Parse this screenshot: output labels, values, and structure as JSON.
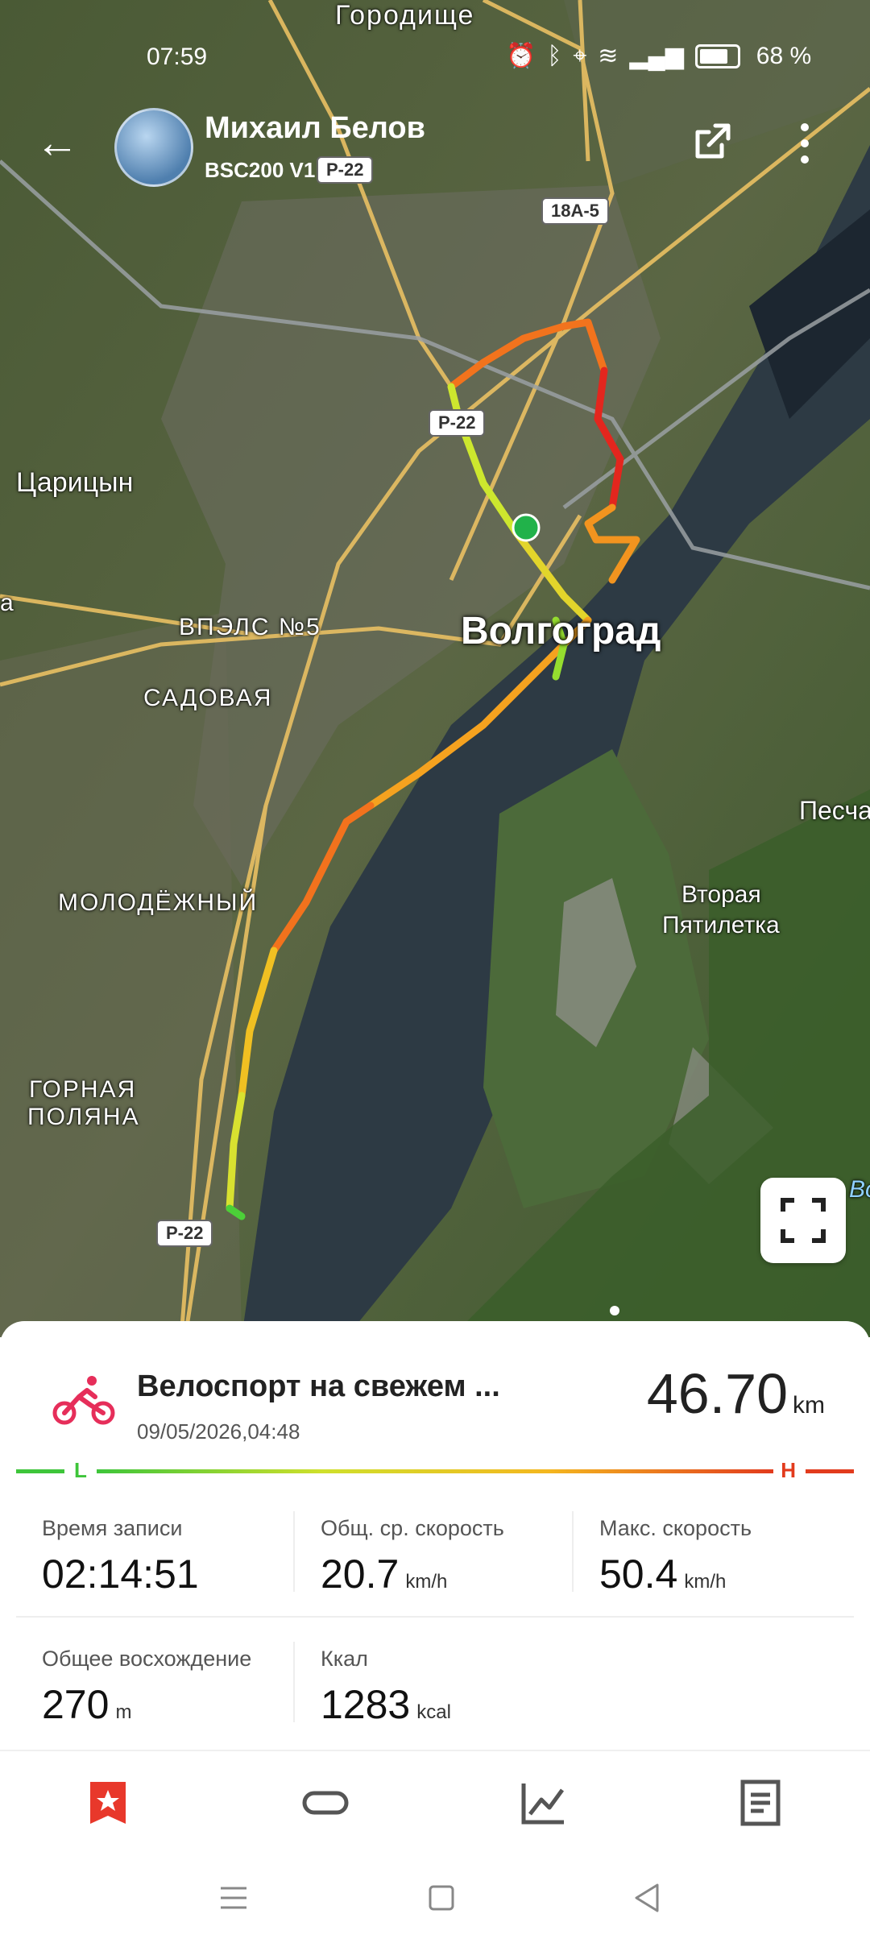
{
  "status": {
    "time": "07:59",
    "battery": "68 %",
    "icons": [
      "alarm-icon",
      "bluetooth-icon",
      "location-icon",
      "wifi-icon",
      "volte-icon",
      "signal-icon",
      "battery-icon"
    ]
  },
  "header": {
    "user_name": "Михаил Белов",
    "device": "BSC200  V1"
  },
  "map": {
    "labels": {
      "gorodishche": "Городище",
      "tsaritsyn": "Царицын",
      "vpels5": "ВПЭЛС №5",
      "sadovaya": "САДОВАЯ",
      "molodezhny": "МОЛОДЁЖНЫЙ",
      "gornaya": "ГОРНАЯ",
      "polyana": "ПОЛЯНА",
      "volgograd": "Волгоград",
      "vtoraya": "Вторая",
      "pyatiletka": "Пятилетка",
      "pescha": "Песча",
      "edge_a": "а",
      "edge_vo": "Во"
    },
    "roads": {
      "r22_top": "Р-22",
      "a185": "18А-5",
      "r22_mid": "Р-22",
      "r22_bottom": "Р-22"
    }
  },
  "activity": {
    "title": "Велоспорт на свежем ...",
    "date": "09/05/2026,04:48",
    "distance": "46.70",
    "distance_unit": "km"
  },
  "speed_scale": {
    "low": "L",
    "high": "H"
  },
  "stats": [
    {
      "label": "Время записи",
      "value": "02:14:51",
      "unit": ""
    },
    {
      "label": "Общ. ср. скорость",
      "value": "20.7",
      "unit": "km/h"
    },
    {
      "label": "Макс. скорость",
      "value": "50.4",
      "unit": "km/h"
    },
    {
      "label": "Общее восхождение",
      "value": "270",
      "unit": "m"
    },
    {
      "label": "Ккал",
      "value": "1283",
      "unit": "kcal"
    }
  ],
  "tabs": [
    "highlights-icon",
    "track-icon",
    "chart-icon",
    "details-icon"
  ],
  "colors": {
    "accent": "#e8382b",
    "slow": "#3ec53a",
    "fast": "#e23b1d"
  }
}
